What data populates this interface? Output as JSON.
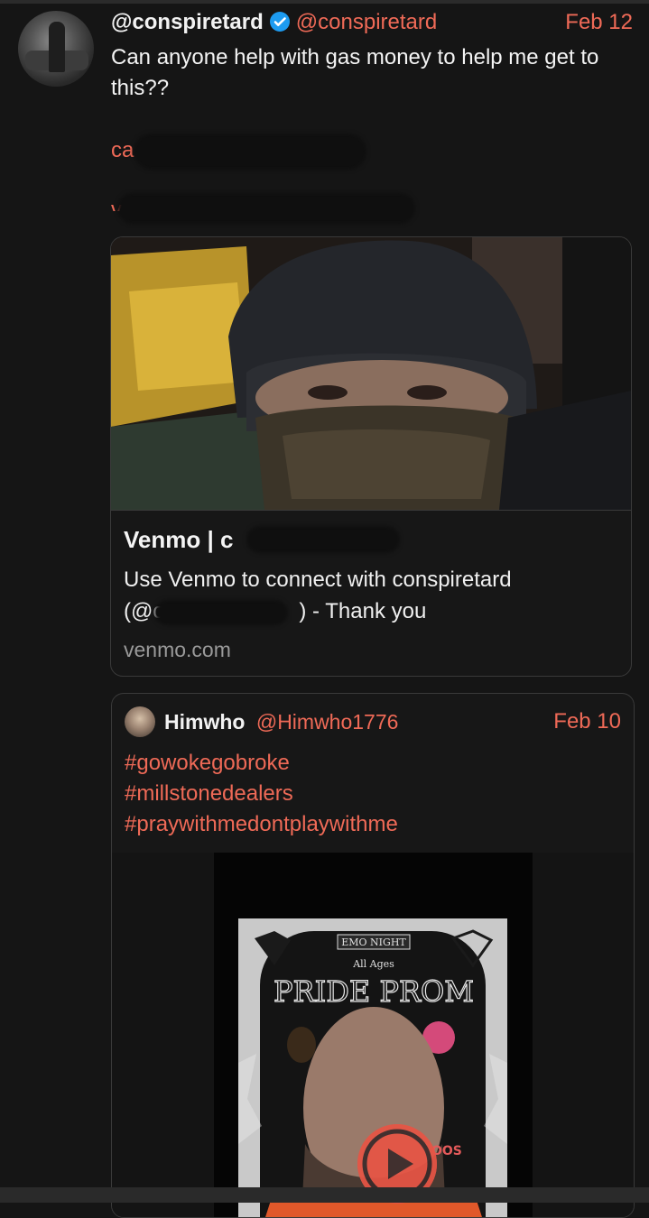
{
  "post": {
    "display_name": "@conspiretard",
    "handle": "@conspiretard",
    "date": "Feb 12",
    "text": "Can anyone help with gas money to help me get to this??",
    "redacted_line1_visible": "ca",
    "redacted_line2_visible": "ve"
  },
  "link_card": {
    "title": "Venmo | c",
    "description_line1": "Use Venmo to connect with conspiretard",
    "description_line2_start": "(@c",
    "description_line2_end": ") - Thank you",
    "domain": "venmo.com"
  },
  "quoted_post": {
    "display_name": "Himwho",
    "handle": "@Himwho1776",
    "date": "Feb 10",
    "tags": [
      "#gowokegobroke",
      "#millstonedealers",
      "#praywithmedontplaywithme"
    ],
    "poster_text": {
      "top": "EMO NIGHT",
      "ages": "All Ages",
      "title": "PRIDE PROM"
    }
  },
  "colors": {
    "background": "#151515",
    "accent": "#ef6a57",
    "verified": "#1d9bf0",
    "play_button": "#e85545"
  },
  "icons": {
    "verified": "verified-badge-icon",
    "play": "play-icon"
  }
}
